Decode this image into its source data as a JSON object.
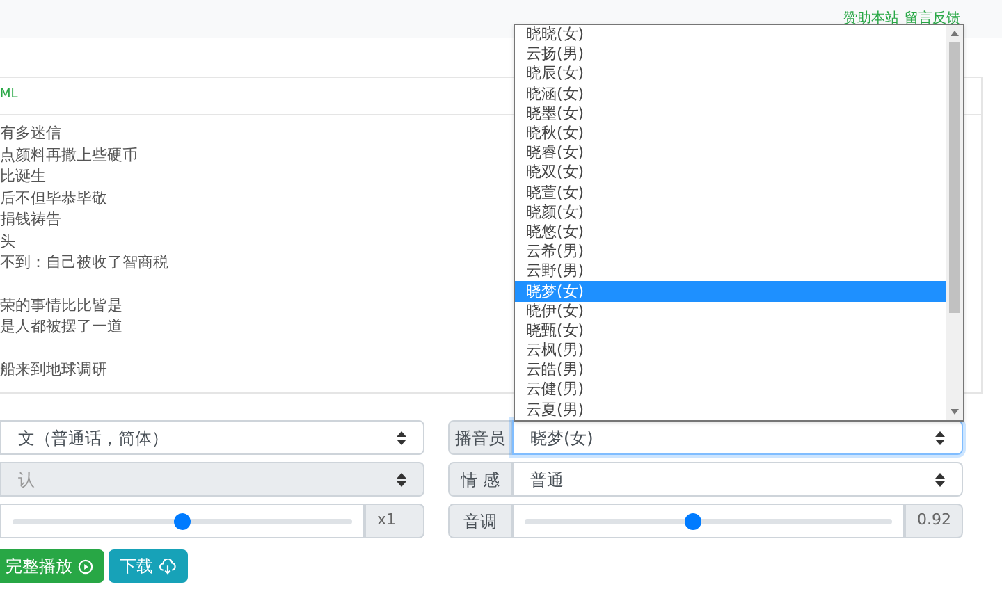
{
  "top_links": [
    "赞助本站",
    "留言反馈"
  ],
  "editor": {
    "mode_tab": "ML",
    "paragraphs": [
      [
        "有多迷信",
        "点颜料再撒上些硬币",
        "比诞生",
        "后不但毕恭毕敬",
        "捐钱祷告",
        "头",
        "不到：自己被收了智商税"
      ],
      [
        "荣的事情比比皆是",
        "是人都被摆了一道"
      ],
      [
        "船来到地球调研"
      ]
    ]
  },
  "language_select": {
    "value": "文（普通话，简体）"
  },
  "style_select": {
    "value": "认",
    "disabled": true
  },
  "speed": {
    "level": 0.5,
    "reading": "x1"
  },
  "voice": {
    "label": "播音员",
    "value": "晓梦(女)",
    "focused": true,
    "options": [
      {
        "label": "晓晓(女)",
        "selected": false
      },
      {
        "label": "云扬(男)",
        "selected": false
      },
      {
        "label": "晓辰(女)",
        "selected": false
      },
      {
        "label": "晓涵(女)",
        "selected": false
      },
      {
        "label": "晓墨(女)",
        "selected": false
      },
      {
        "label": "晓秋(女)",
        "selected": false
      },
      {
        "label": "晓睿(女)",
        "selected": false
      },
      {
        "label": "晓双(女)",
        "selected": false
      },
      {
        "label": "晓萱(女)",
        "selected": false
      },
      {
        "label": "晓颜(女)",
        "selected": false
      },
      {
        "label": "晓悠(女)",
        "selected": false
      },
      {
        "label": "云希(男)",
        "selected": false
      },
      {
        "label": "云野(男)",
        "selected": false
      },
      {
        "label": "晓梦(女)",
        "selected": true
      },
      {
        "label": "晓伊(女)",
        "selected": false
      },
      {
        "label": "晓甄(女)",
        "selected": false
      },
      {
        "label": "云枫(男)",
        "selected": false
      },
      {
        "label": "云皓(男)",
        "selected": false
      },
      {
        "label": "云健(男)",
        "selected": false
      },
      {
        "label": "云夏(男)",
        "selected": false
      }
    ]
  },
  "emotion": {
    "label": "情 感",
    "value": "普通"
  },
  "pitch": {
    "label": "音调",
    "level": 0.46,
    "reading": "0.92"
  },
  "buttons": [
    {
      "kind": "play",
      "label": "完整播放"
    },
    {
      "kind": "download",
      "label": "下载"
    }
  ]
}
